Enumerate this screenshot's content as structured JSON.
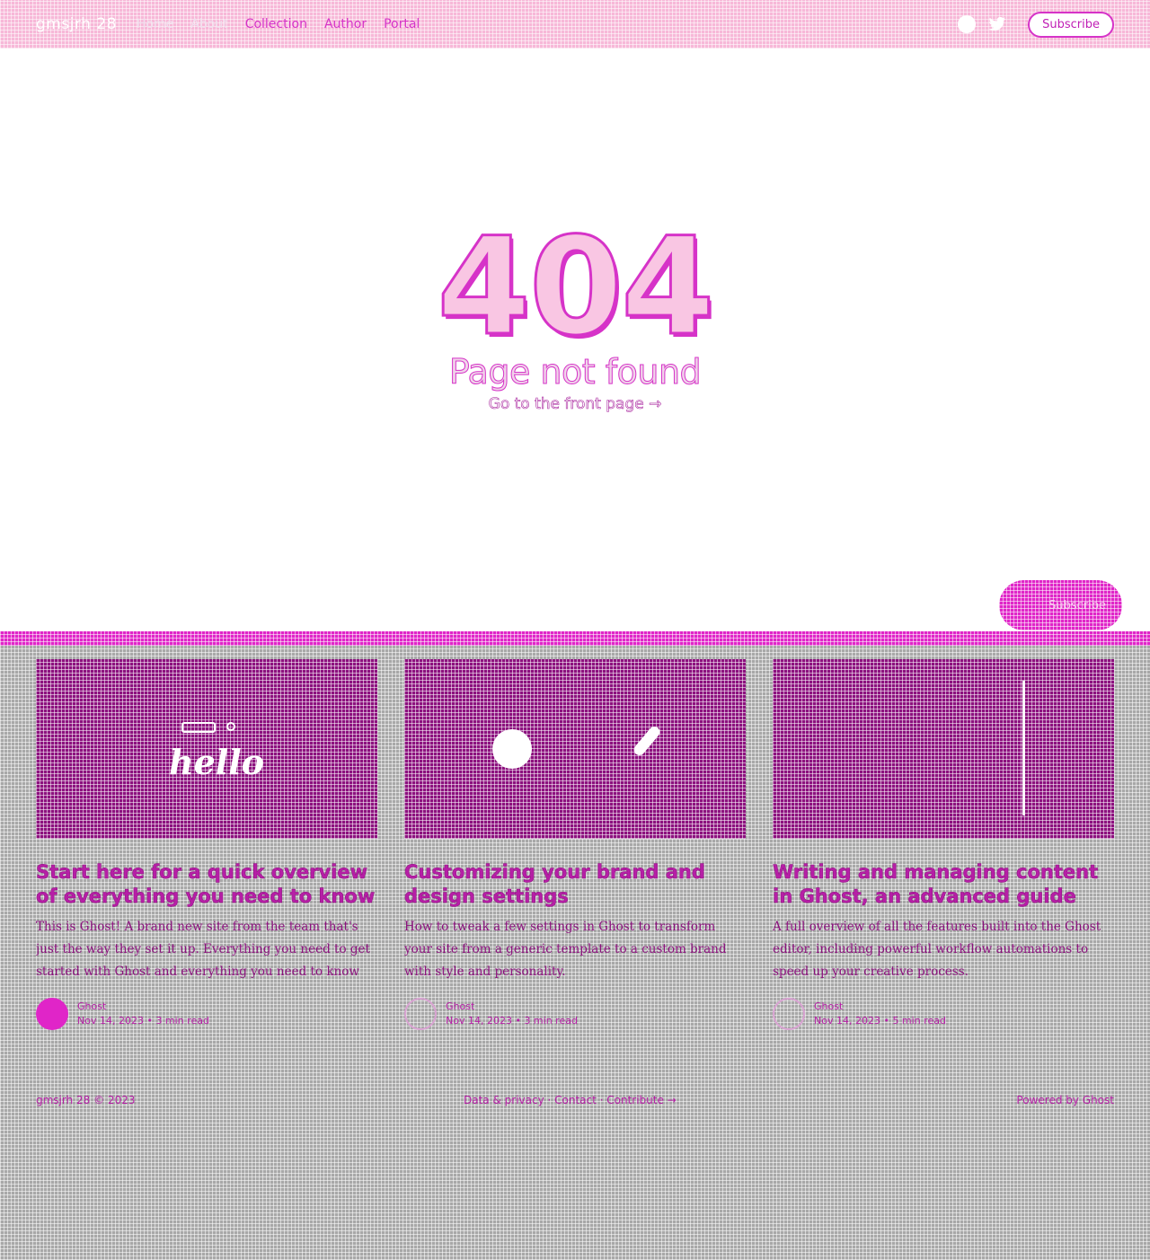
{
  "header": {
    "brand": "gmsjrh 28",
    "nav": [
      "Home",
      "About",
      "Collection",
      "Author",
      "Portal"
    ],
    "subscribe": "Subscribe"
  },
  "not_found": {
    "code": "404",
    "message": "Page not found",
    "link": "Go to the front page →"
  },
  "floating_subscribe": "Subscribe",
  "cards": [
    {
      "title": "Start here for a quick overview of everything you need to know",
      "excerpt": "This is Ghost! A brand new site from the team that's just the way they set it up. Everything you need to get started with Ghost and everything you need to know about the editor along with more advanced features for your publication.",
      "img_text": "hello",
      "author": "Ghost",
      "date": "Nov 14, 2023",
      "read": "3 min read"
    },
    {
      "title": "Customizing your brand and design settings",
      "excerpt": "How to tweak a few settings in Ghost to transform your site from a generic template to a custom brand with style and personality.",
      "author": "Ghost",
      "date": "Nov 14, 2023",
      "read": "3 min read"
    },
    {
      "title": "Writing and managing content in Ghost, an advanced guide",
      "excerpt": "A full overview of all the features built into the Ghost editor, including powerful workflow automations to speed up your creative process.",
      "author": "Ghost",
      "date": "Nov 14, 2023",
      "read": "5 min read"
    }
  ],
  "footer": {
    "copyright": "gmsjrh 28 © 2023",
    "links": "Data & privacy · Contact · Contribute →",
    "powered": "Powered by Ghost"
  },
  "colors": {
    "accent": "#e025c8",
    "header_bg": "#f7b8d8",
    "card_img": "#8c117e",
    "bottom_bg": "#a8a8a8"
  }
}
